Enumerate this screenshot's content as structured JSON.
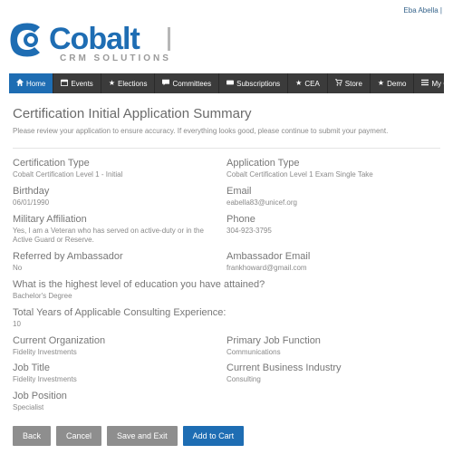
{
  "topbar": {
    "user": "Eba Abella",
    "sep": "|"
  },
  "brand": {
    "main": "Cobalt",
    "sub": "CRM SOLUTIONS"
  },
  "nav": [
    {
      "label": "Home",
      "icon": "home"
    },
    {
      "label": "Events",
      "icon": "calendar"
    },
    {
      "label": "Elections",
      "icon": "star"
    },
    {
      "label": "Committees",
      "icon": "comment"
    },
    {
      "label": "Subscriptions",
      "icon": "subs"
    },
    {
      "label": "CEA",
      "icon": "star"
    },
    {
      "label": "Store",
      "icon": "cart"
    },
    {
      "label": "Demo",
      "icon": "star"
    },
    {
      "label": "My Orders",
      "icon": "list"
    }
  ],
  "page": {
    "title": "Certification Initial Application Summary",
    "instruction": "Please review your application to ensure accuracy. If everything looks good, please continue to submit your payment."
  },
  "fields": {
    "cert_type": {
      "label": "Certification Type",
      "value": "Cobalt Certification Level 1 - Initial"
    },
    "app_type": {
      "label": "Application Type",
      "value": "Cobalt Certification Level 1 Exam Single Take"
    },
    "birthday": {
      "label": "Birthday",
      "value": "06/01/1990"
    },
    "email": {
      "label": "Email",
      "value": "eabella83@unicef.org"
    },
    "military": {
      "label": "Military Affiliation",
      "value": "Yes, I am a Veteran who has served on active-duty or in the Active Guard or Reserve."
    },
    "phone": {
      "label": "Phone",
      "value": "304-923-3795"
    },
    "referred": {
      "label": "Referred by Ambassador",
      "value": "No"
    },
    "amb_email": {
      "label": "Ambassador Email",
      "value": "frankhoward@gmail.com"
    },
    "education": {
      "label": "What is the highest level of education you have attained?",
      "value": "Bachelor's Degree"
    },
    "experience": {
      "label": "Total Years of Applicable Consulting Experience:",
      "value": "10"
    },
    "org": {
      "label": "Current Organization",
      "value": "Fidelity Investments"
    },
    "job_function": {
      "label": "Primary Job Function",
      "value": "Communications"
    },
    "job_title": {
      "label": "Job Title",
      "value": "Fidelity Investments"
    },
    "industry": {
      "label": "Current Business Industry",
      "value": "Consulting"
    },
    "position": {
      "label": "Job Position",
      "value": "Specialist"
    }
  },
  "buttons": {
    "back": "Back",
    "cancel": "Cancel",
    "save_exit": "Save and Exit",
    "add_cart": "Add to Cart"
  }
}
